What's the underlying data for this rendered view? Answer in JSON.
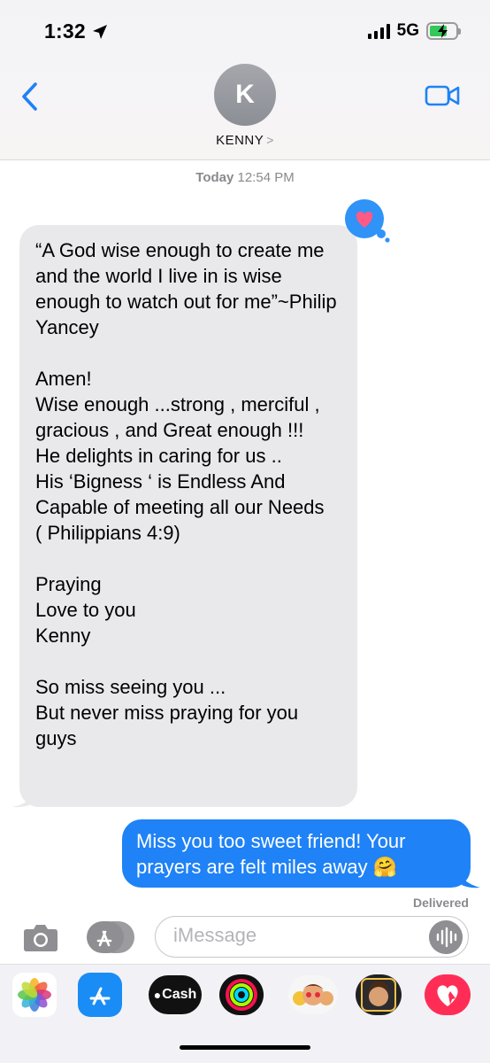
{
  "status_bar": {
    "time": "1:32",
    "network": "5G"
  },
  "header": {
    "avatar_initial": "K",
    "contact_name": "KENNY",
    "contact_chevron": ">"
  },
  "thread": {
    "timestamp_day": "Today",
    "timestamp_time": "12:54 PM",
    "incoming_message": "“A God wise enough to create me and the world I live in is wise enough to watch out for me”~Philip Yancey\n\nAmen!\nWise enough ...strong , merciful , gracious , and Great enough !!!\nHe delights in caring for us ..\nHis ‘Bigness ‘ is Endless And Capable of meeting all our Needs\n( Philippians 4:9)\n\nPraying\nLove to you\nKenny\n\nSo miss seeing you ...\nBut never miss praying for you guys",
    "reaction": "heart",
    "outgoing_message": "Miss you too sweet friend! Your prayers are felt miles away 🤗",
    "delivery_status": "Delivered"
  },
  "composer": {
    "placeholder": "iMessage"
  },
  "app_drawer": {
    "cash_label": "Cash",
    "apps": [
      "photos-icon",
      "app-store-icon",
      "apple-cash-icon",
      "activity-icon",
      "memoji-stickers-icon",
      "memoji-icon",
      "digital-touch-icon"
    ]
  },
  "colors": {
    "accent": "#1f82f6",
    "incoming_bubble": "#e9e9eb",
    "reaction_heart": "#ff4d7a"
  }
}
